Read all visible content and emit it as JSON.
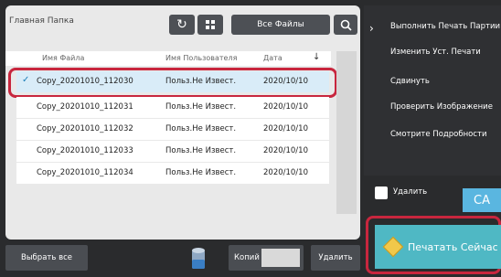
{
  "toolbar": {
    "folder": "Главная Папка",
    "all_files": "Все Файлы"
  },
  "table": {
    "headers": {
      "name": "Имя Файла",
      "user": "Имя Пользователя",
      "date": "Дата"
    },
    "rows": [
      {
        "name": "Copy_20201010_112030",
        "user": "Польз.Не Извест.",
        "date": "2020/10/10",
        "selected": true
      },
      {
        "name": "Copy_20201010_112031",
        "user": "Польз.Не Извест.",
        "date": "2020/10/10"
      },
      {
        "name": "Copy_20201010_112032",
        "user": "Польз.Не Извест.",
        "date": "2020/10/10"
      },
      {
        "name": "Copy_20201010_112033",
        "user": "Польз.Не Извест.",
        "date": "2020/10/10"
      },
      {
        "name": "Copy_20201010_112034",
        "user": "Польз.Не Извест.",
        "date": "2020/10/10"
      }
    ]
  },
  "bottom": {
    "select_all": "Выбрать все",
    "copies": "Копий",
    "copies_value": "",
    "delete": "Удалить"
  },
  "right_menu": {
    "items": [
      "Выполнить Печать Партии",
      "Изменить Уст. Печати",
      "Сдвинуть",
      "Проверить Изображение",
      "Смотрите Подробности"
    ],
    "delete_checkbox": "Удалить",
    "ca": "CA",
    "print_now": "Печатать Сейчас"
  },
  "colors": {
    "highlight": "#c8263e",
    "print_button": "#4fb8c4",
    "ca_button": "#5ab6e0"
  }
}
